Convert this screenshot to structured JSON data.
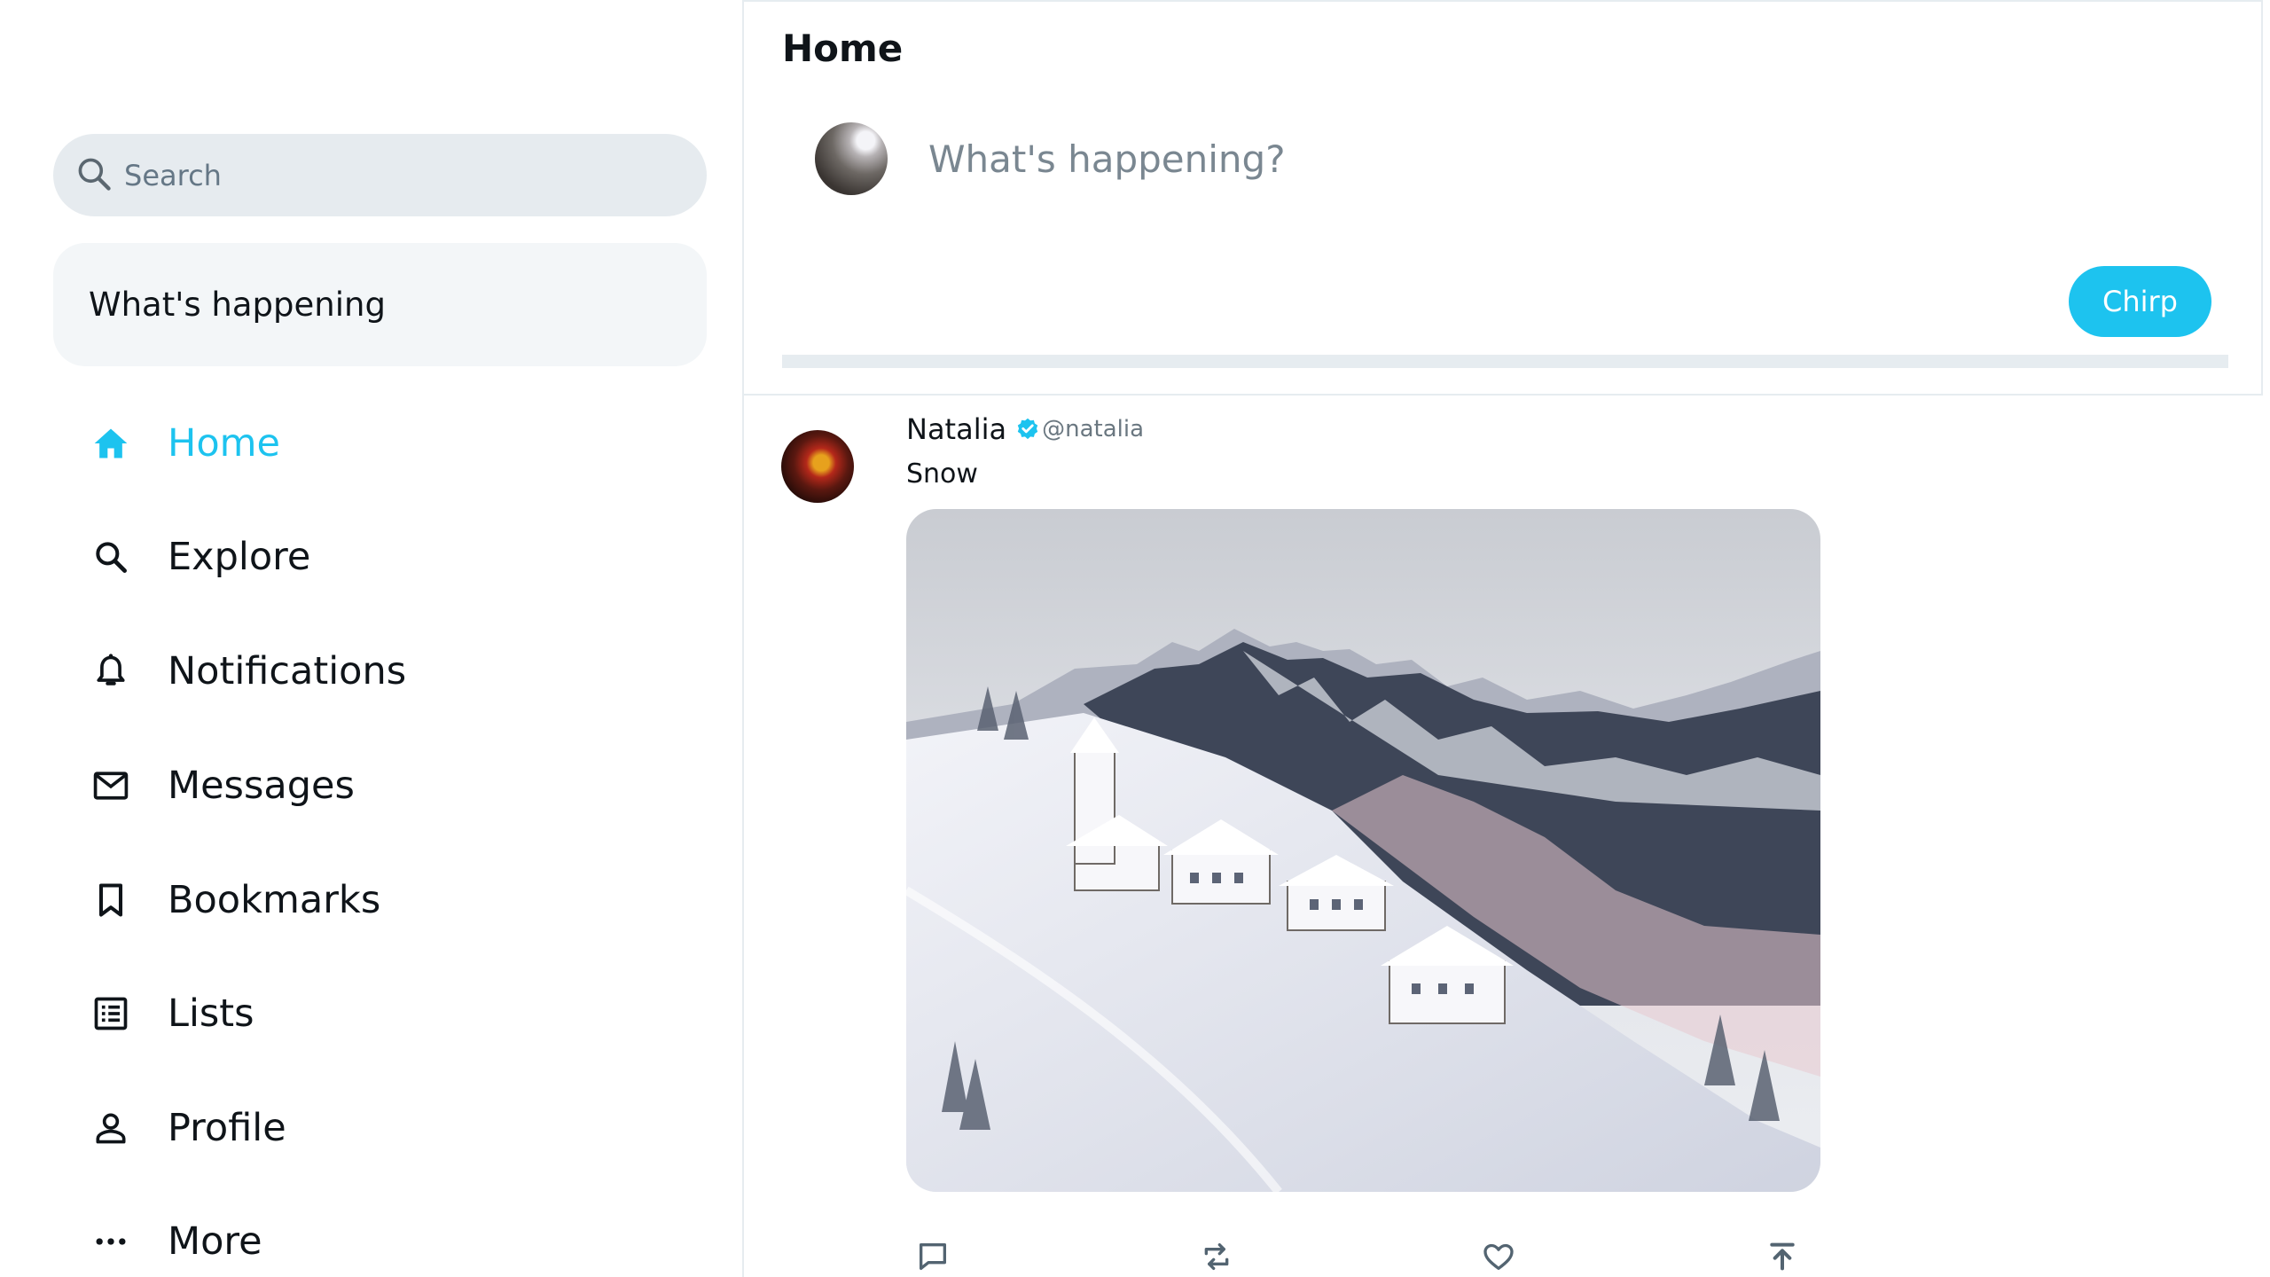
{
  "search": {
    "placeholder": "Search",
    "icon": "search-icon"
  },
  "trends": {
    "title": "What's happening"
  },
  "nav": {
    "accent_color": "#1dc3ef",
    "items": [
      {
        "label": "Home",
        "icon": "home-icon",
        "active": true
      },
      {
        "label": "Explore",
        "icon": "search-icon",
        "active": false
      },
      {
        "label": "Notifications",
        "icon": "bell-icon",
        "active": false
      },
      {
        "label": "Messages",
        "icon": "envelope-icon",
        "active": false
      },
      {
        "label": "Bookmarks",
        "icon": "bookmark-icon",
        "active": false
      },
      {
        "label": "Lists",
        "icon": "list-icon",
        "active": false
      },
      {
        "label": "Profile",
        "icon": "person-icon",
        "active": false
      },
      {
        "label": "More",
        "icon": "more-icon",
        "active": false
      }
    ]
  },
  "main": {
    "title": "Home",
    "composer": {
      "placeholder": "What's happening?",
      "submit_label": "Chirp",
      "button_color": "#1dc3ef"
    },
    "feed": [
      {
        "author": "Natalia",
        "verified": true,
        "handle": "@natalia",
        "text": "Snow",
        "image": "snowy-mountain-village-photo",
        "actions": [
          "reply-icon",
          "retweet-icon",
          "like-icon",
          "share-icon"
        ]
      }
    ]
  }
}
